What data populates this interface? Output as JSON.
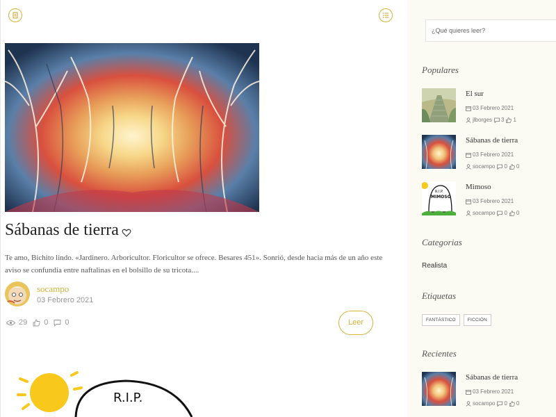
{
  "main": {
    "post": {
      "title": "Sábanas de tierra",
      "excerpt": "Te amo, Bichito lindo. «Jardinero. Arboricultor. Floricultor se ofrece. Besares 451». Sonrió, desde hacia más de un año este aviso se confundía entre naftalinas en el bolsillo de su tricota....",
      "author": "socampo",
      "date": "03 Febrero 2021",
      "views": "29",
      "likes": "0",
      "comments": "0",
      "read_label": "Leer"
    },
    "second_post_image_text": "R.I.P."
  },
  "sidebar": {
    "search_placeholder": "¿Qué quieres leer?",
    "popular_title": "Populares",
    "popular": [
      {
        "title": "El sur",
        "date": "03 Febrero 2021",
        "author": "jlborges",
        "comments": "3",
        "likes": "1"
      },
      {
        "title": "Sábanas de tierra",
        "date": "03 Febrero 2021",
        "author": "socampo",
        "comments": "0",
        "likes": "0"
      },
      {
        "title": "Mimoso",
        "date": "03 Febrero 2021",
        "author": "socampo",
        "comments": "0",
        "likes": "0",
        "thumb_text": "MIMOSO",
        "thumb_rip": "R.I.P."
      }
    ],
    "categories_title": "Categorias",
    "categories": [
      "Realista"
    ],
    "tags_title": "Etiquetas",
    "tags": [
      "FANTÁSTICO",
      "FICCIÓN"
    ],
    "recent_title": "Recientes",
    "recent": [
      {
        "title": "Sábanas de tierra",
        "date": "03 Febrero 2021",
        "author": "socampo",
        "comments": "0",
        "likes": "0"
      }
    ]
  },
  "colors": {
    "accent": "#d6b33a",
    "sidebar_bg": "#fbfaf3"
  }
}
